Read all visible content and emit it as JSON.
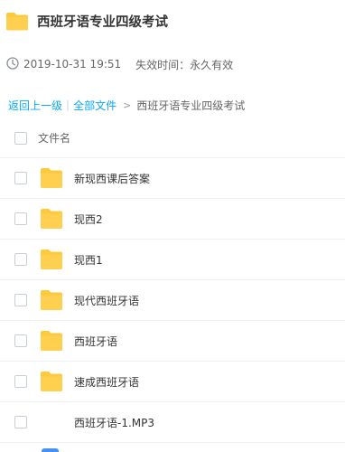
{
  "header": {
    "title": "西班牙语专业四级考试",
    "icon": "folder-icon",
    "folder_color": "#ffc93e"
  },
  "meta": {
    "datetime": "2019-10-31 19:51",
    "expire": "失效时间：永久有效"
  },
  "breadcrumb": {
    "back_label": "返回上一级",
    "separator": "|",
    "all_files_label": "全部文件",
    "arrow": ">",
    "current": "西班牙语专业四级考试",
    "link_color": "#09aaff"
  },
  "table": {
    "column_header": "文件名",
    "rows": [
      {
        "name": "新现西课后答案",
        "type": "folder"
      },
      {
        "name": "现西2",
        "type": "folder"
      },
      {
        "name": "现西1",
        "type": "folder"
      },
      {
        "name": "现代西班牙语",
        "type": "folder"
      },
      {
        "name": "西班牙语",
        "type": "folder"
      },
      {
        "name": "速成西班牙语",
        "type": "folder"
      },
      {
        "name": "西班牙语-1.MP3",
        "type": "audio"
      }
    ]
  }
}
